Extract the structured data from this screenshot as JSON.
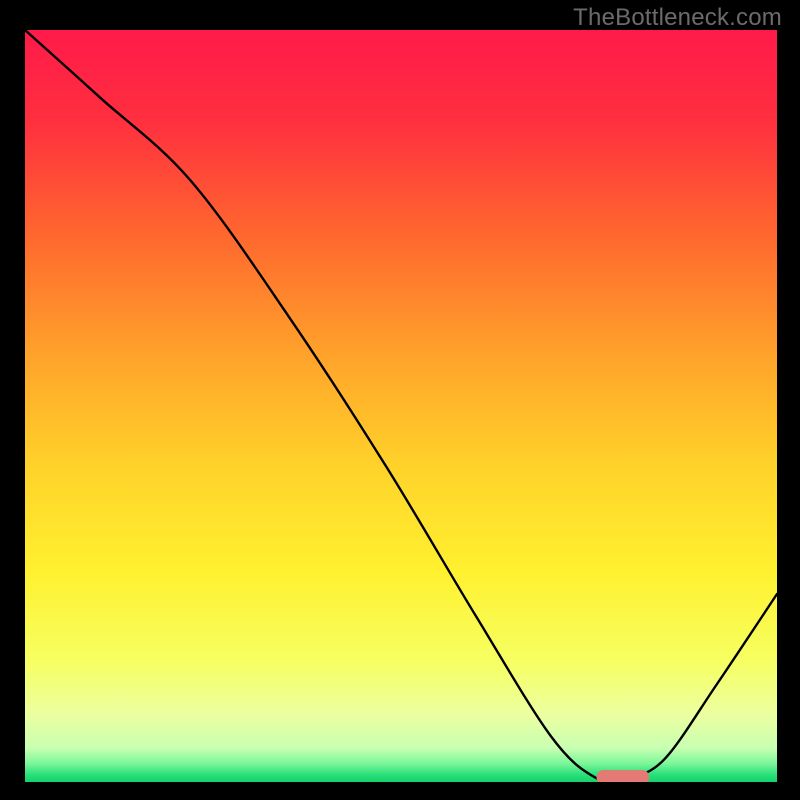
{
  "watermark": "TheBottleneck.com",
  "chart_data": {
    "type": "line",
    "title": "",
    "xlabel": "",
    "ylabel": "",
    "xlim": [
      0,
      100
    ],
    "ylim": [
      0,
      100
    ],
    "x": [
      0,
      10,
      22,
      35,
      48,
      60,
      70,
      76,
      80,
      85,
      92,
      100
    ],
    "values": [
      100,
      91,
      80,
      62,
      42,
      22,
      6,
      0.5,
      0.5,
      3,
      13,
      25
    ],
    "gradient_stops": [
      {
        "offset": 0.0,
        "color": "#ff1a4a"
      },
      {
        "offset": 0.12,
        "color": "#ff2f3f"
      },
      {
        "offset": 0.28,
        "color": "#ff6a2e"
      },
      {
        "offset": 0.44,
        "color": "#ffa52a"
      },
      {
        "offset": 0.58,
        "color": "#ffd22a"
      },
      {
        "offset": 0.72,
        "color": "#fff12f"
      },
      {
        "offset": 0.84,
        "color": "#f6ff62"
      },
      {
        "offset": 0.91,
        "color": "#ecffa0"
      },
      {
        "offset": 0.955,
        "color": "#c8ffb2"
      },
      {
        "offset": 0.975,
        "color": "#7df79a"
      },
      {
        "offset": 0.99,
        "color": "#2be07a"
      },
      {
        "offset": 1.0,
        "color": "#14d26a"
      }
    ],
    "marker": {
      "x_start": 76,
      "x_end": 83,
      "y": 0.65,
      "color": "#e47a74",
      "height_pct": 1.9
    }
  }
}
